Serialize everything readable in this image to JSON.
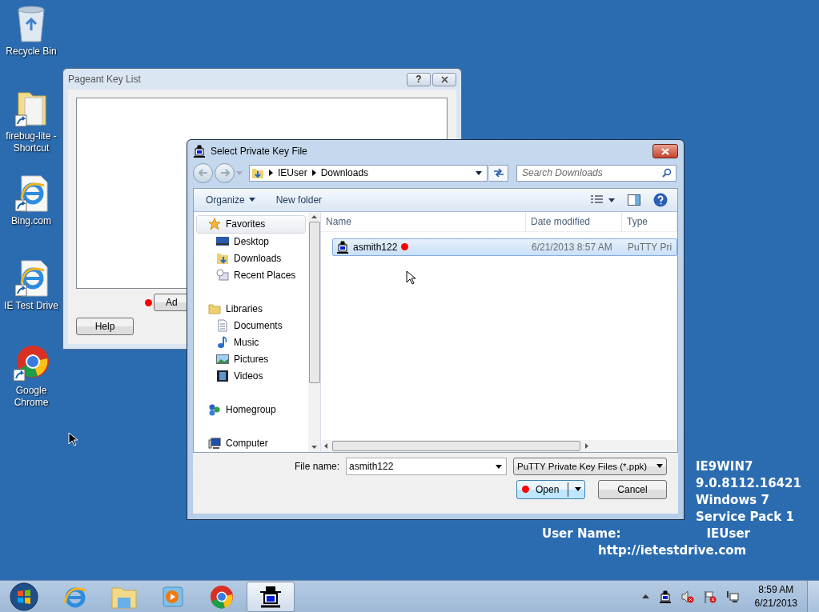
{
  "desktop_icons": [
    {
      "label": "Recycle Bin",
      "kind": "recycle"
    },
    {
      "label": "firebug-lite - Shortcut",
      "kind": "folder"
    },
    {
      "label": "Bing.com",
      "kind": "ie"
    },
    {
      "label": "IE Test Drive",
      "kind": "ie"
    },
    {
      "label": "Google Chrome",
      "kind": "chrome"
    }
  ],
  "pageant": {
    "title": "Pageant Key List",
    "help_glyph": "?",
    "add_button": "Ad",
    "help_button": "Help"
  },
  "dialog": {
    "title": "Select Private Key File",
    "breadcrumb": [
      "IEUser",
      "Downloads"
    ],
    "search": {
      "placeholder": "Search Downloads"
    },
    "toolbar": [
      "Organize",
      "New folder"
    ],
    "nav": [
      {
        "label": "Favorites",
        "kind": "favorites",
        "selected": true,
        "children": [
          {
            "label": "Desktop",
            "kind": "desktop",
            "selected": false
          },
          {
            "label": "Downloads",
            "kind": "downloads",
            "selected": false
          },
          {
            "label": "Recent Places",
            "kind": "recent",
            "selected": false
          }
        ]
      },
      {
        "label": "Libraries",
        "kind": "libraries",
        "selected": false,
        "children": [
          {
            "label": "Documents",
            "kind": "documents",
            "selected": false
          },
          {
            "label": "Music",
            "kind": "music",
            "selected": false
          },
          {
            "label": "Pictures",
            "kind": "pictures",
            "selected": false
          },
          {
            "label": "Videos",
            "kind": "videos",
            "selected": false
          }
        ]
      },
      {
        "label": "Homegroup",
        "kind": "homegroup",
        "selected": false
      },
      {
        "label": "Computer",
        "kind": "computer",
        "selected": false
      }
    ],
    "columns": [
      "Name",
      "Date modified",
      "Type"
    ],
    "rows": [
      {
        "name": "asmith122",
        "date": "6/21/2013 8:57 AM",
        "type": "PuTTY Pri",
        "selected": true
      }
    ],
    "file_name": {
      "label": "File name:",
      "value": "asmith122"
    },
    "file_type": "PuTTY Private Key Files (*.ppk)",
    "open_button": "Open",
    "cancel_button": "Cancel"
  },
  "info": {
    "lines": [
      "IE9WIN7",
      "9.0.8112.16421",
      "Windows 7",
      "Service Pack 1"
    ],
    "user_label": "User Name:",
    "user_value": "IEUser",
    "url": "http://ietestdrive.com"
  },
  "taskbar": {
    "apps": [
      {
        "kind": "start",
        "selected": false
      },
      {
        "kind": "ie",
        "selected": false
      },
      {
        "kind": "explorer",
        "selected": false
      },
      {
        "kind": "media",
        "selected": false
      },
      {
        "kind": "chrome",
        "selected": false
      },
      {
        "kind": "putty",
        "selected": true
      }
    ],
    "time": "8:59 AM",
    "date": "6/21/2013"
  }
}
